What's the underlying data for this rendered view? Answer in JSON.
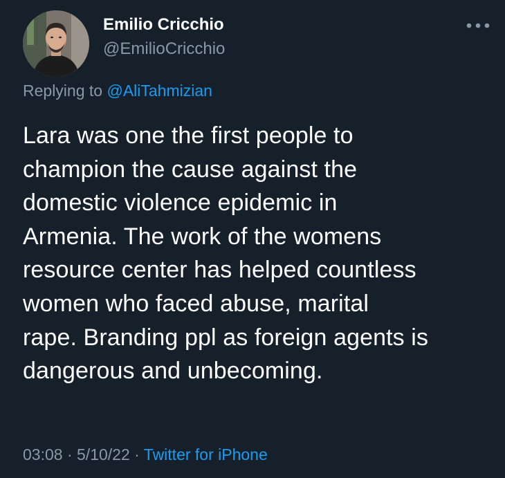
{
  "theme": {
    "background": "#15202b",
    "text_primary": "#ffffff",
    "text_secondary": "#8b98a5",
    "accent": "#1d9bf0"
  },
  "author": {
    "display_name": "Emilio Cricchio",
    "handle": "@EmilioCricchio",
    "avatar_icon": "profile-photo"
  },
  "more_button": {
    "icon": "more-horizontal-icon"
  },
  "reply_context": {
    "prefix": "Replying to ",
    "mention": "@AliTahmizian"
  },
  "tweet": {
    "text": "Lara was one the first people to\nchampion the cause against the\ndomestic violence epidemic in\nArmenia. The work of the womens\nresource center has helped countless\nwomen who faced abuse, marital\nrape. Branding ppl as foreign agents is\ndangerous and unbecoming."
  },
  "meta": {
    "time": "03:08",
    "separator": " · ",
    "date": "5/10/22",
    "source": "Twitter for iPhone"
  }
}
